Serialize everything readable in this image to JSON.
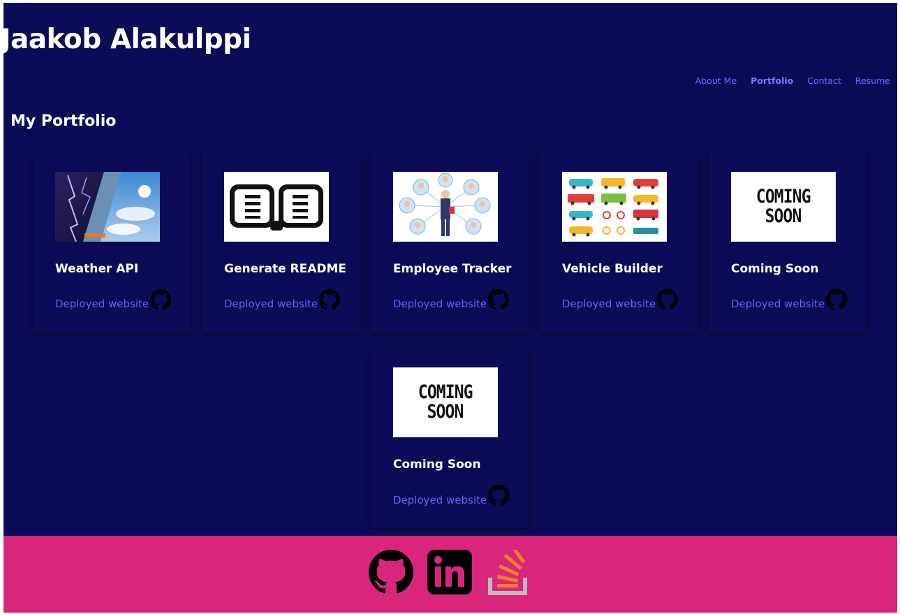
{
  "header": {
    "title": "Jaakob Alakulppi",
    "nav": [
      "About Me",
      "Portfolio",
      "Contact",
      "Resume"
    ],
    "active_nav": "Portfolio"
  },
  "portfolio": {
    "heading": "My Portfolio",
    "projects": [
      {
        "name": "Weather API",
        "link_label": "Deployed website",
        "thumb": "storm-and-sky-image"
      },
      {
        "name": "Generate README",
        "link_label": "Deployed website",
        "thumb": "open-book-image"
      },
      {
        "name": "Employee Tracker",
        "link_label": "Deployed website",
        "thumb": "team-network-image"
      },
      {
        "name": "Vehicle Builder",
        "link_label": "Deployed website",
        "thumb": "vehicles-grid-image"
      },
      {
        "name": "Coming Soon",
        "link_label": "Deployed website",
        "thumb": "coming-soon-image",
        "thumb_text": [
          "COMING",
          "SOON"
        ]
      },
      {
        "name": "Coming Soon",
        "link_label": "Deployed website",
        "thumb": "coming-soon-image",
        "thumb_text": [
          "COMING",
          "SOON"
        ]
      }
    ]
  },
  "footer": {
    "icons": [
      "github-icon",
      "linkedin-icon",
      "stackoverflow-icon"
    ]
  },
  "colors": {
    "background": "#0b0b58",
    "accent": "#6262f0",
    "footer": "#d9267c"
  }
}
